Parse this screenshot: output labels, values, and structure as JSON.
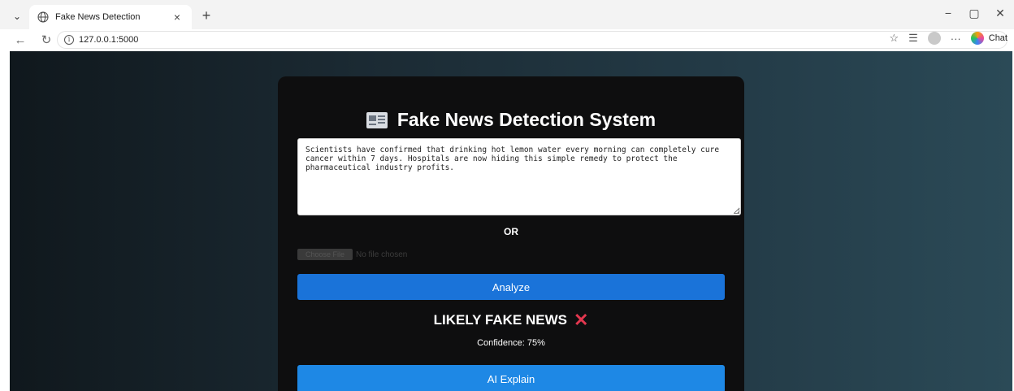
{
  "browser": {
    "tab_title": "Fake News Detection",
    "tab_close": "×",
    "new_tab": "+",
    "url": "127.0.0.1:5000",
    "minimize": "−",
    "maximize": "▢",
    "close": "✕",
    "chat_label": "Chat",
    "icons": [
      "tab-list-icon",
      "globe-icon",
      "back-icon",
      "refresh-icon",
      "info-icon",
      "favorite-icon",
      "favorites-list-icon",
      "profile-icon",
      "more-icon",
      "copilot-icon"
    ]
  },
  "app": {
    "title": "Fake News Detection System",
    "news_text": "Scientists have confirmed that drinking hot lemon water every morning can completely cure cancer within 7 days. Hospitals are now hiding this simple remedy to protect the pharmaceutical industry profits.",
    "or_label": "OR",
    "file_button": "Choose File",
    "file_status": "No file chosen",
    "analyze_label": "Analyze",
    "verdict": "LIKELY FAKE NEWS",
    "confidence": "Confidence: 75%",
    "explain_label": "AI Explain"
  },
  "colors": {
    "primary_button": "#1a73d9",
    "explain_button": "#1e88e5",
    "fake_cross": "#e2374f",
    "card_bg": "#0e0e0f"
  }
}
